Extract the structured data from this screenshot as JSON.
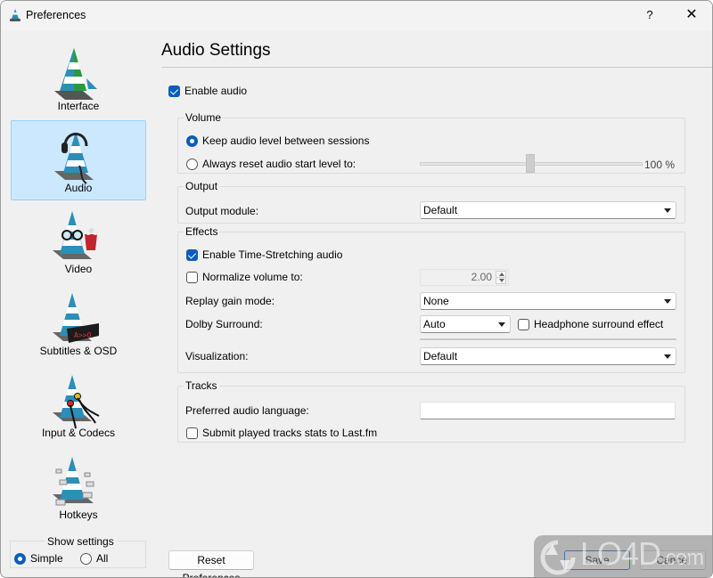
{
  "window": {
    "title": "Preferences",
    "help_label": "?",
    "close_label": "✕"
  },
  "sidebar": {
    "items": [
      {
        "label": "Interface",
        "icon": "vlc-cone-interface-icon",
        "selected": false
      },
      {
        "label": "Audio",
        "icon": "vlc-cone-headphones-icon",
        "selected": true
      },
      {
        "label": "Video",
        "icon": "vlc-cone-glasses-popcorn-icon",
        "selected": false
      },
      {
        "label": "Subtitles & OSD",
        "icon": "vlc-cone-display-icon",
        "selected": false
      },
      {
        "label": "Input & Codecs",
        "icon": "vlc-cone-cables-icon",
        "selected": false
      },
      {
        "label": "Hotkeys",
        "icon": "vlc-cone-keys-icon",
        "selected": false
      }
    ],
    "show_settings": {
      "legend": "Show settings",
      "options": [
        {
          "label": "Simple",
          "selected": true
        },
        {
          "label": "All",
          "selected": false
        }
      ]
    }
  },
  "main": {
    "title": "Audio Settings",
    "enable_audio": {
      "label": "Enable audio",
      "checked": true
    },
    "volume": {
      "legend": "Volume",
      "keep_level": {
        "label": "Keep audio level between sessions",
        "selected": true
      },
      "always_reset": {
        "label": "Always reset audio start level to:",
        "selected": false
      },
      "level_percent": 100,
      "level_text": "100 %"
    },
    "output": {
      "legend": "Output",
      "module_label": "Output module:",
      "module_value": "Default"
    },
    "effects": {
      "legend": "Effects",
      "time_stretching": {
        "label": "Enable Time-Stretching audio",
        "checked": true
      },
      "normalize": {
        "label": "Normalize volume to:",
        "checked": false,
        "value": "2.00"
      },
      "replay_gain_label": "Replay gain mode:",
      "replay_gain_value": "None",
      "dolby_label": "Dolby Surround:",
      "dolby_value": "Auto",
      "headphone": {
        "label": "Headphone surround effect",
        "checked": false
      },
      "visualization_label": "Visualization:",
      "visualization_value": "Default"
    },
    "tracks": {
      "legend": "Tracks",
      "preferred_language_label": "Preferred audio language:",
      "preferred_language_value": "",
      "lastfm": {
        "label": "Submit played tracks stats to Last.fm",
        "checked": false
      }
    }
  },
  "footer": {
    "reset_label": "Reset Preferences",
    "save_label": "Save",
    "cancel_label": "Cancel"
  },
  "watermark": {
    "text": "LO4D",
    "suffix": ".com"
  },
  "colors": {
    "accent": "#0a5dbb",
    "selected_bg": "#cce8ff",
    "window_bg": "#f0f0f0"
  }
}
